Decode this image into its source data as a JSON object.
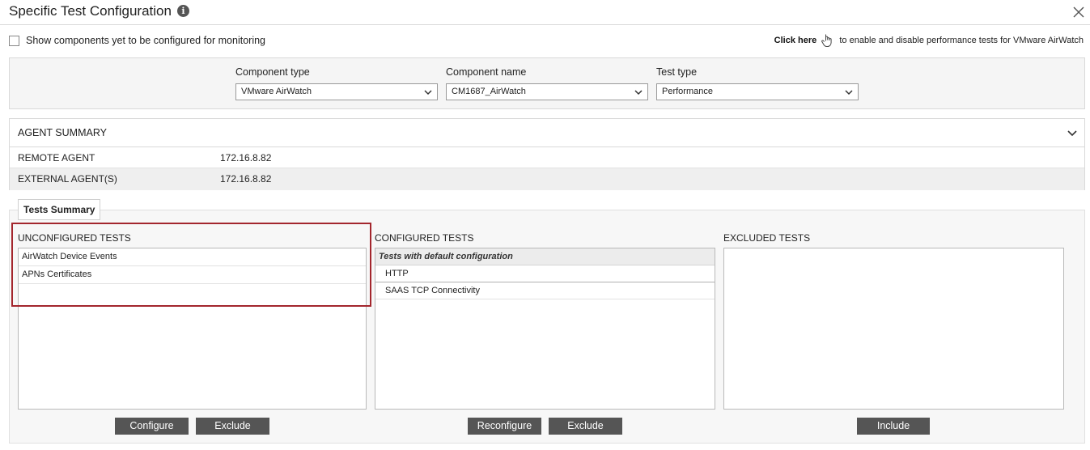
{
  "dialog": {
    "title": "Specific Test Configuration",
    "info_icon": "info-icon",
    "close_icon": "close-icon"
  },
  "options": {
    "show_unconfigured_label": "Show components yet to be configured for monitoring",
    "show_unconfigured_checked": false,
    "click_here_label": "Click here",
    "click_here_suffix": "to enable and disable performance tests for VMware AirWatch",
    "hand_icon": "hand-pointer-icon"
  },
  "filters": {
    "component_type": {
      "label": "Component type",
      "value": "VMware AirWatch"
    },
    "component_name": {
      "label": "Component name",
      "value": "CM1687_AirWatch"
    },
    "test_type": {
      "label": "Test type",
      "value": "Performance"
    }
  },
  "agent_summary": {
    "title": "AGENT SUMMARY",
    "rows": [
      {
        "key": "REMOTE AGENT",
        "value": "172.16.8.82"
      },
      {
        "key": "EXTERNAL AGENT(S)",
        "value": "172.16.8.82"
      }
    ]
  },
  "tests_summary": {
    "tab_label": "Tests Summary",
    "unconfigured": {
      "title": "UNCONFIGURED TESTS",
      "items": [
        "AirWatch Device Events",
        "APNs Certificates"
      ]
    },
    "configured": {
      "title": "CONFIGURED TESTS",
      "group_label": "Tests with default configuration",
      "items": [
        "HTTP",
        "SAAS TCP Connectivity"
      ]
    },
    "excluded": {
      "title": "EXCLUDED TESTS",
      "items": []
    }
  },
  "buttons": {
    "configure": "Configure",
    "exclude_unconfigured": "Exclude",
    "reconfigure": "Reconfigure",
    "exclude_configured": "Exclude",
    "include": "Include"
  },
  "colors": {
    "highlight_border": "#a3262d",
    "button_bg": "#555555"
  }
}
